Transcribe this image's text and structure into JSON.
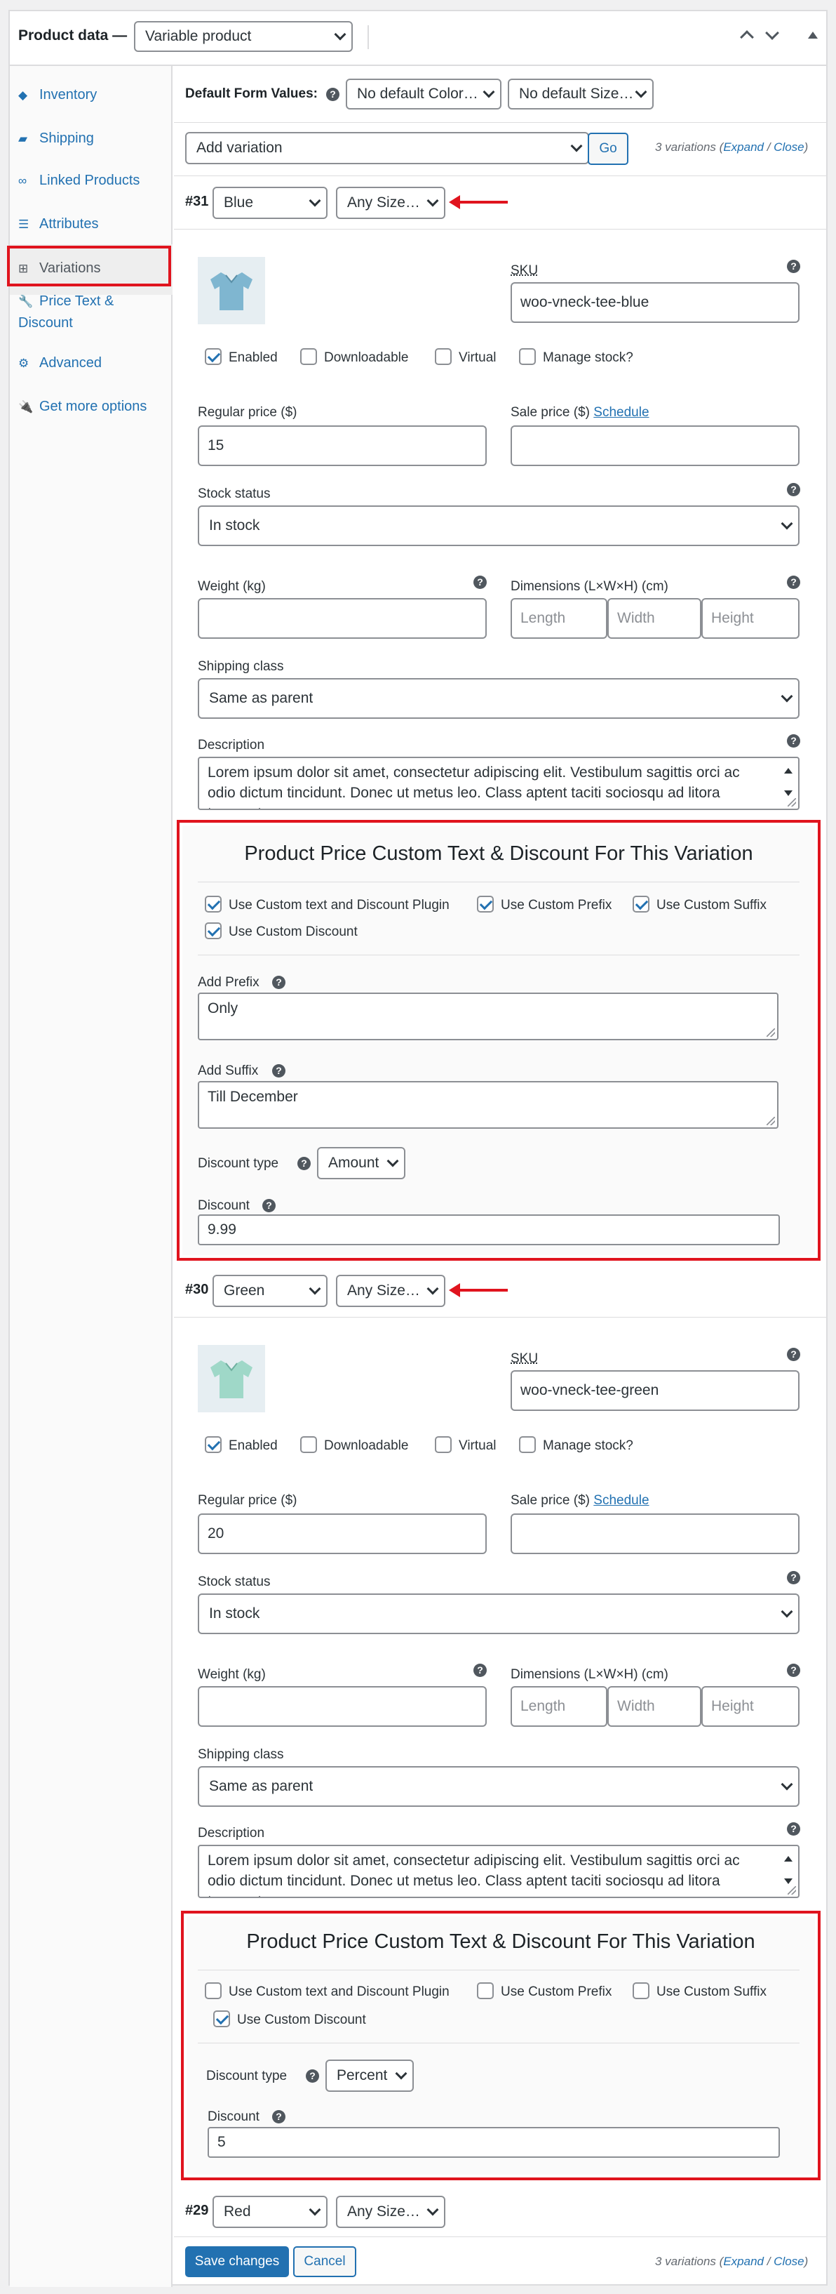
{
  "header": {
    "title": "Product data —",
    "product_type": "Variable product"
  },
  "sidebar": {
    "items": [
      {
        "label": "Inventory",
        "icon": "diamond-icon"
      },
      {
        "label": "Shipping",
        "icon": "truck-icon"
      },
      {
        "label": "Linked Products",
        "icon": "link-icon"
      },
      {
        "label": "Attributes",
        "icon": "list-icon"
      },
      {
        "label": "Variations",
        "icon": "grid-icon"
      },
      {
        "label": "Price Text & Discount",
        "icon": "wrench-icon"
      },
      {
        "label": "Advanced",
        "icon": "gear-icon"
      },
      {
        "label": "Get more options",
        "icon": "plugin-icon"
      }
    ]
  },
  "defaults": {
    "label": "Default Form Values:",
    "color": "No default Color…",
    "size": "No default Size…"
  },
  "add": {
    "select": "Add variation",
    "go": "Go",
    "count": "3 variations (",
    "expand": "Expand",
    "sep": " / ",
    "close": "Close",
    ")": ")"
  },
  "labels": {
    "sku": "SKU",
    "enabled": "Enabled",
    "downloadable": "Downloadable",
    "virtual": "Virtual",
    "manage": "Manage stock?",
    "regular": "Regular price ($)",
    "sale": "Sale price ($)",
    "schedule": "Schedule",
    "stock": "Stock status",
    "weight": "Weight (kg)",
    "dimensions": "Dimensions (L×W×H) (cm)",
    "length": "Length",
    "width": "Width",
    "height": "Height",
    "shipclass": "Shipping class",
    "description": "Description",
    "custom_title": "Product Price Custom Text & Discount For This Variation",
    "use_plugin": "Use Custom text and Discount Plugin",
    "use_prefix": "Use Custom Prefix",
    "use_suffix": "Use Custom Suffix",
    "use_discount": "Use Custom Discount",
    "add_prefix": "Add Prefix",
    "add_suffix": "Add Suffix",
    "discount_type": "Discount type",
    "discount": "Discount"
  },
  "variations": [
    {
      "id": "#31",
      "color": "Blue",
      "size": "Any Size…",
      "sku": "woo-vneck-tee-blue",
      "regular": "15",
      "sale": "",
      "stock": "In stock",
      "shipping": "Same as parent",
      "description": "Lorem ipsum dolor sit amet, consectetur adipiscing elit. Vestibulum sagittis orci ac odio dictum tincidunt. Donec ut metus leo. Class aptent taciti sociosqu ad litora torquent per",
      "enabled": true,
      "plugin": true,
      "prefix_on": true,
      "suffix_on": true,
      "discount_on": true,
      "prefix": "Only",
      "suffix": "Till December",
      "discount_type": "Amount",
      "discount": "9.99",
      "tee_color": "#7fb6d0"
    },
    {
      "id": "#30",
      "color": "Green",
      "size": "Any Size…",
      "sku": "woo-vneck-tee-green",
      "regular": "20",
      "sale": "",
      "stock": "In stock",
      "shipping": "Same as parent",
      "description": "Lorem ipsum dolor sit amet, consectetur adipiscing elit. Vestibulum sagittis orci ac odio dictum tincidunt. Donec ut metus leo. Class aptent taciti sociosqu ad litora torquent per",
      "enabled": true,
      "plugin": false,
      "prefix_on": false,
      "suffix_on": false,
      "discount_on": true,
      "discount_type": "Percent",
      "discount": "5",
      "tee_color": "#9fd8c8"
    },
    {
      "id": "#29",
      "color": "Red",
      "size": "Any Size…"
    }
  ],
  "footer": {
    "save": "Save changes",
    "cancel": "Cancel"
  },
  "colors": {
    "accent": "#2271b1",
    "highlight": "#e0141e"
  }
}
